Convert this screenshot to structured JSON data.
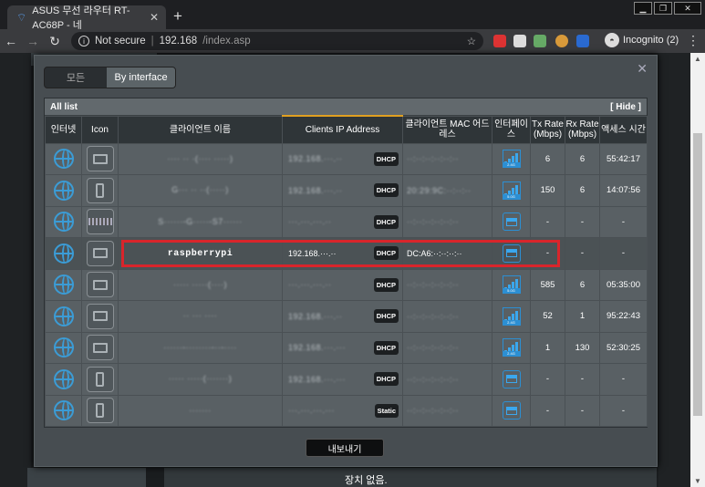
{
  "browser": {
    "tab_title": "ASUS 무선 라우터 RT-AC68P - 네",
    "tab_close": "✕",
    "new_tab": "+",
    "url_security": "Not secure",
    "url_sep": "|",
    "url_host": "192.168",
    "url_path": "/index.asp",
    "incognito_label": "Incognito (2)",
    "window_controls": [
      "▁",
      "❐",
      "✕"
    ]
  },
  "modal": {
    "close": "✕",
    "filter_tabs": [
      "모든",
      "By interface"
    ],
    "list_title": "All list",
    "hide_label": "[ Hide ]",
    "headers": [
      "인터넷",
      "Icon",
      "클라이언트 이름",
      "Clients IP Address",
      "클라이언트 MAC 어드레스",
      "인터페이스",
      "Tx Rate (Mbps)",
      "Rx Rate (Mbps)",
      "액세스 시간"
    ],
    "rows": [
      {
        "device": "laptop",
        "name": "···· ·· ·(···· ·····)",
        "ip": "192.168.···.··",
        "ip_type": "DHCP",
        "mac": "··:··:··:··:··:··",
        "iface": "2.4G",
        "tx": "6",
        "rx": "6",
        "time": "55:42:17"
      },
      {
        "device": "phone",
        "name": "G··· ·· ··(·····)",
        "ip": "192.168.···.··",
        "ip_type": "DHCP",
        "mac": "20:29:9C:··:··:··",
        "iface": "5.0G",
        "tx": "150",
        "rx": "6",
        "time": "14:07:56"
      },
      {
        "device": "router",
        "name": "S······-G·····-S7······",
        "ip": "···.···.···.··",
        "ip_type": "DHCP",
        "mac": "··:··:··:··:··:··",
        "iface": "wired",
        "tx": "-",
        "rx": "-",
        "time": "-"
      },
      {
        "device": "laptop",
        "name": "raspberrypi",
        "ip": "192.168.···.··",
        "ip_type": "DHCP",
        "mac": "DC:A6:··:··:··:··",
        "iface": "wired",
        "tx": "-",
        "rx": "-",
        "time": "-",
        "highlighted": true
      },
      {
        "device": "laptop",
        "name": "····· ·····(····)",
        "ip": "···.···.···.··",
        "ip_type": "DHCP",
        "mac": "··:··:··:··:··:··",
        "iface": "5.0G",
        "tx": "585",
        "rx": "6",
        "time": "05:35:00"
      },
      {
        "device": "laptop",
        "name": "·· ··· ····",
        "ip": "192.168.···.··",
        "ip_type": "DHCP",
        "mac": "··:··:··:··:··:··",
        "iface": "2.4G",
        "tx": "52",
        "rx": "1",
        "time": "95:22:43"
      },
      {
        "device": "laptop",
        "name": "······-········-··-····",
        "ip": "192.168.···.···",
        "ip_type": "DHCP",
        "mac": "··:··:··:··:··:··",
        "iface": "2.4G",
        "tx": "1",
        "rx": "130",
        "time": "52:30:25"
      },
      {
        "device": "phone",
        "name": "····· ·····(·······)",
        "ip": "192.168.···.···",
        "ip_type": "DHCP",
        "mac": "··:··:··:··:··:··",
        "iface": "wired",
        "tx": "-",
        "rx": "-",
        "time": "-"
      },
      {
        "device": "phone",
        "name": "·······",
        "ip": "···.···.···.···",
        "ip_type": "Static",
        "mac": "··:··:··:··:··:··",
        "iface": "wired",
        "tx": "-",
        "rx": "-",
        "time": "-"
      }
    ],
    "export_button": "내보내기"
  },
  "page": {
    "bottom_text": "장치 없음."
  },
  "colors": {
    "accent": "#3aa7ee",
    "highlight": "#d9252b",
    "tab_underline": "#e0a020"
  }
}
